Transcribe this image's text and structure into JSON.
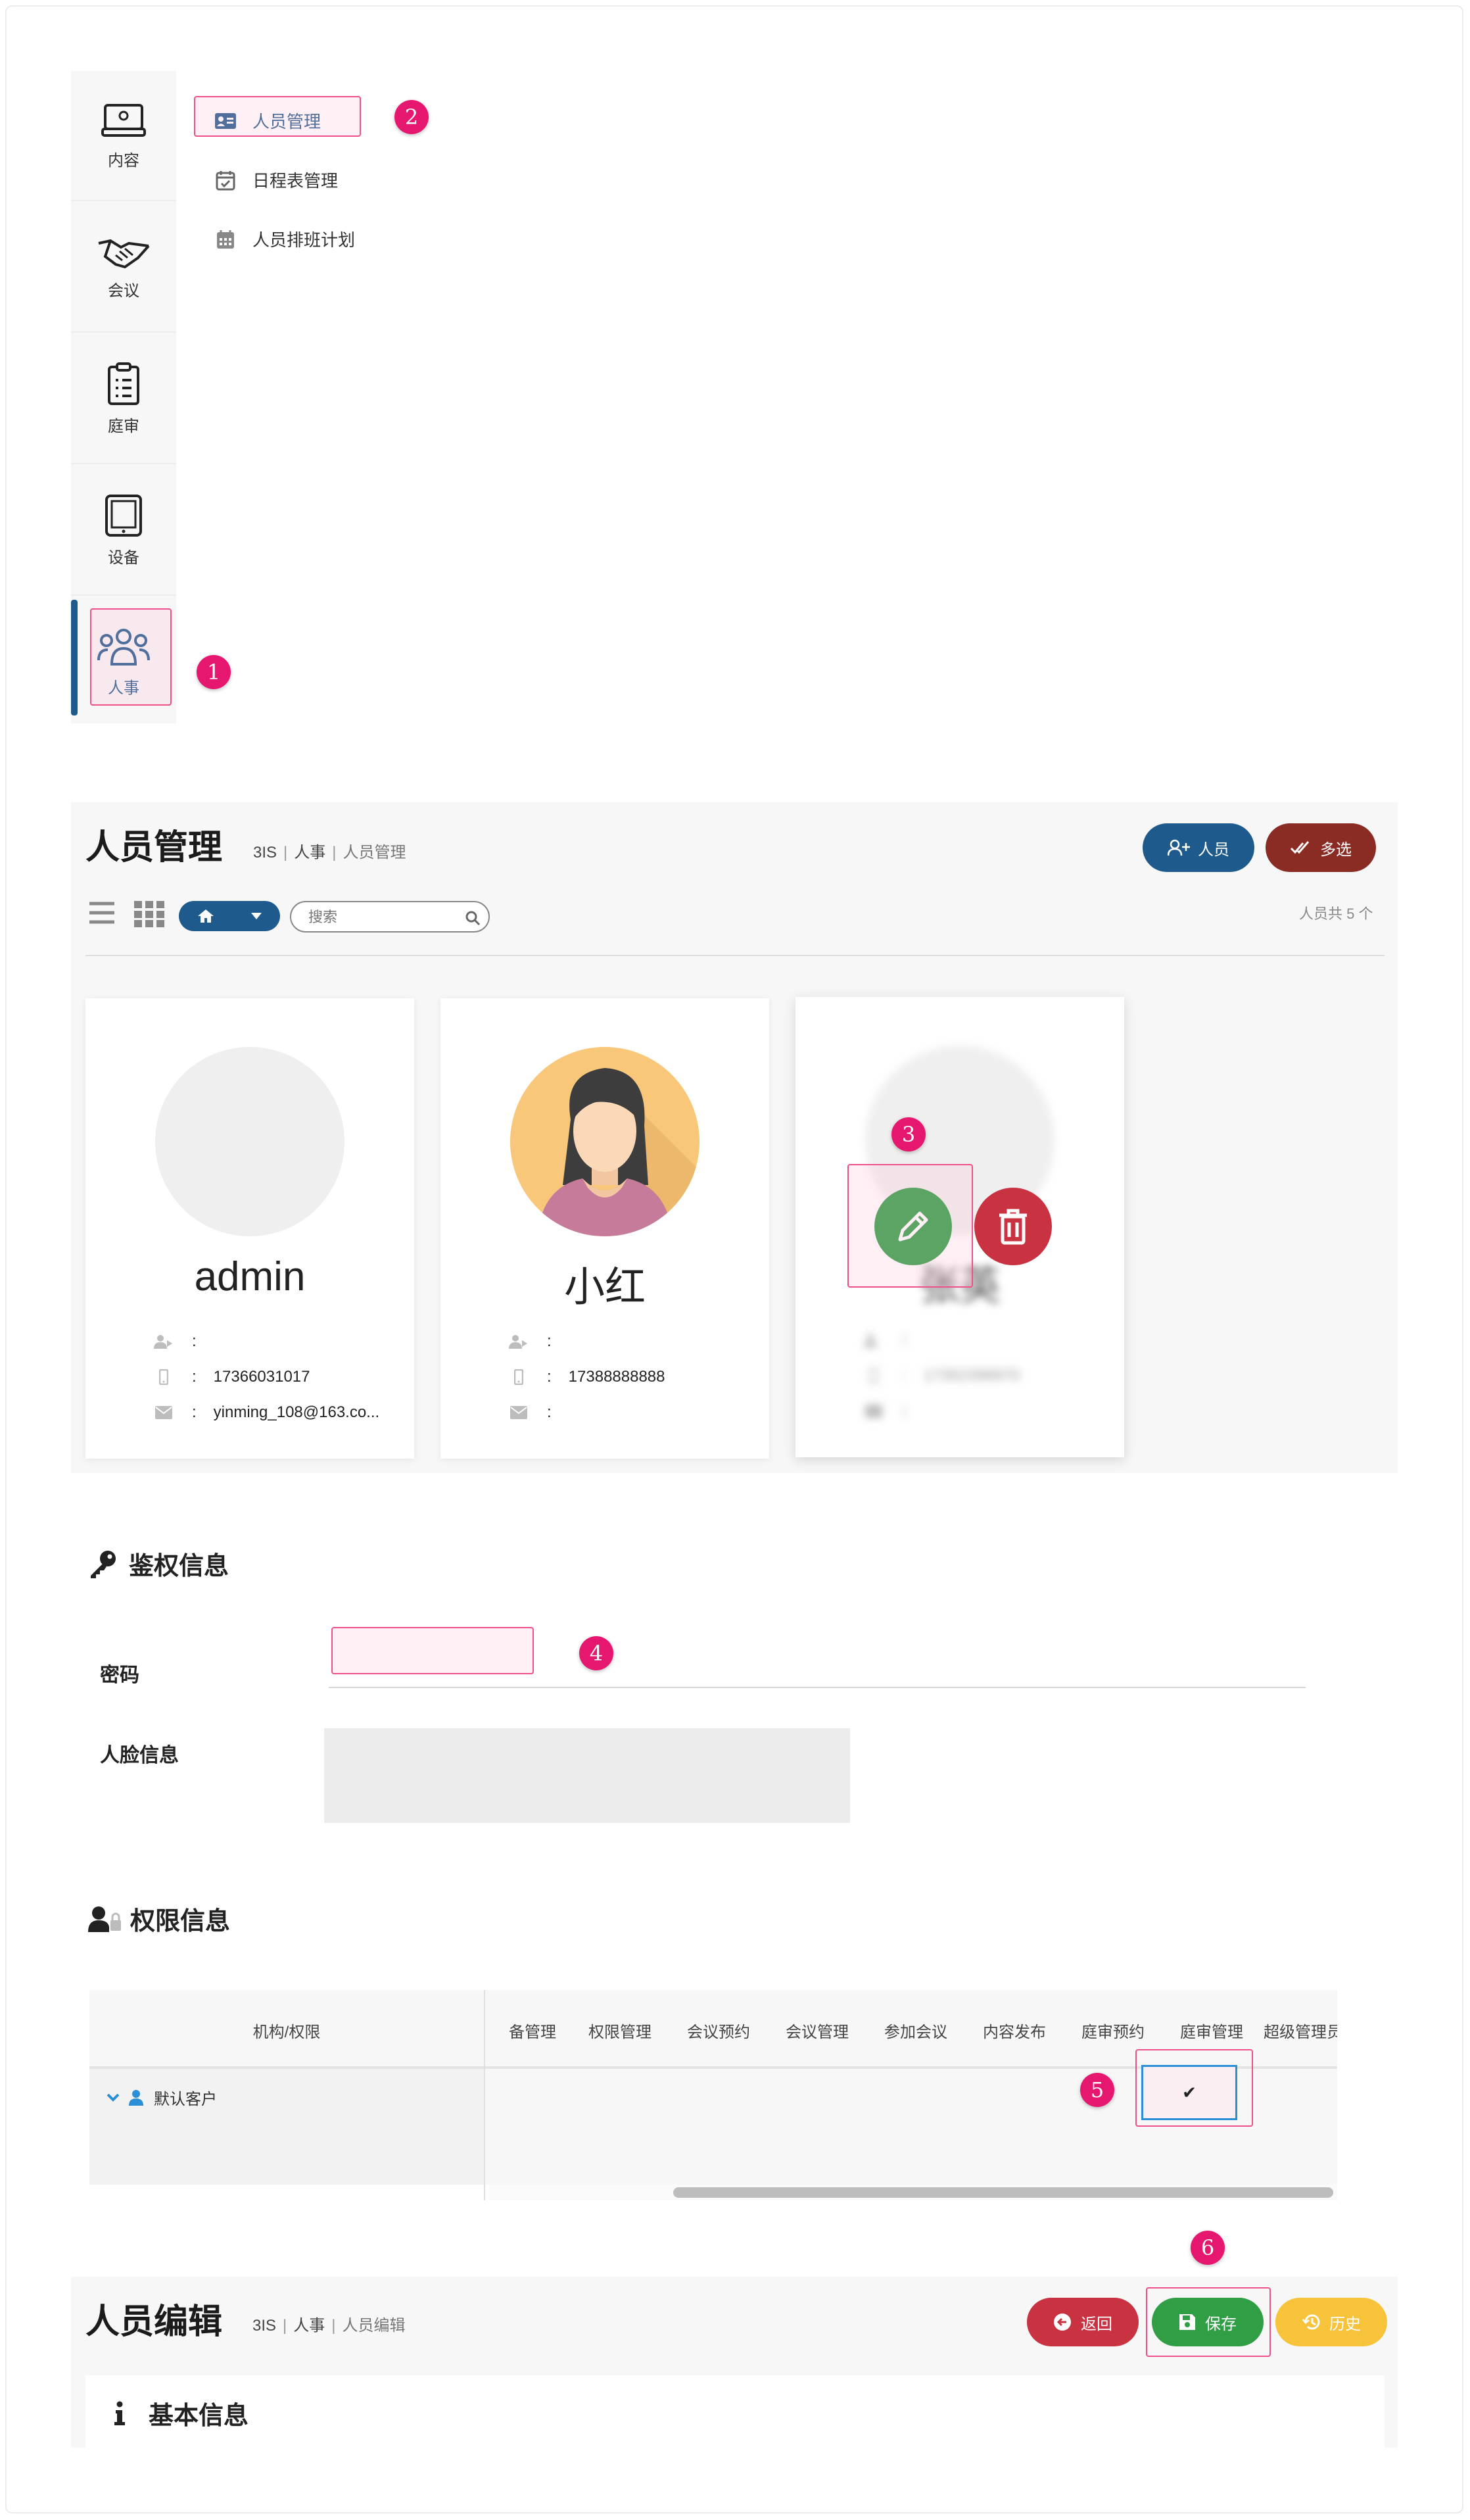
{
  "sidebar": {
    "items": [
      {
        "label": "内容",
        "icon": "monitor-icon"
      },
      {
        "label": "会议",
        "icon": "handshake-icon"
      },
      {
        "label": "庭审",
        "icon": "clipboard-icon"
      },
      {
        "label": "设备",
        "icon": "tablet-icon"
      },
      {
        "label": "人事",
        "icon": "users-icon"
      }
    ],
    "active_color": "#1f5a8c"
  },
  "submenu": {
    "items": [
      {
        "label": "人员管理",
        "icon": "id-card-icon"
      },
      {
        "label": "日程表管理",
        "icon": "calendar-check-icon"
      },
      {
        "label": "人员排班计划",
        "icon": "calendar-grid-icon"
      }
    ]
  },
  "badges": [
    "1",
    "2",
    "3",
    "4",
    "5",
    "6"
  ],
  "people_page": {
    "title": "人员管理",
    "breadcrumb": [
      "3IS",
      "人事",
      "人员管理"
    ],
    "add_person_label": "人员",
    "multi_select_label": "多选",
    "search_placeholder": "搜索",
    "count_text": "人员共 5 个",
    "cards": [
      {
        "name": "admin",
        "role": ":",
        "phone": "17366031017",
        "email": "yinming_108@163.co..."
      },
      {
        "name": "小红",
        "role": ":",
        "phone": "17388888888",
        "email": ":"
      },
      {
        "name": "张英",
        "role": ":",
        "phone": "17352398970",
        "email": ":"
      }
    ],
    "phone_colon": ":",
    "email_colon": ":"
  },
  "auth_section": {
    "title": "鉴权信息",
    "password_label": "密码",
    "face_label": "人脸信息"
  },
  "permission_section": {
    "title": "权限信息",
    "org_header": "机构/权限",
    "columns": [
      "备管理",
      "权限管理",
      "会议预约",
      "会议管理",
      "参加会议",
      "内容发布",
      "庭审预约",
      "庭审管理",
      "超级管理员"
    ],
    "row_label": "默认客户",
    "check": "✔"
  },
  "edit_page": {
    "title": "人员编辑",
    "breadcrumb": [
      "3IS",
      "人事",
      "人员编辑"
    ],
    "back_label": "返回",
    "save_label": "保存",
    "history_label": "历史",
    "basic_info": "基本信息"
  },
  "colors": {
    "primary_blue": "#1f5a8c",
    "dark_red": "#8b2c24",
    "green": "#2f9e44",
    "red": "#c93240",
    "yellow": "#f7c33a",
    "badge_pink": "#e6176f"
  }
}
